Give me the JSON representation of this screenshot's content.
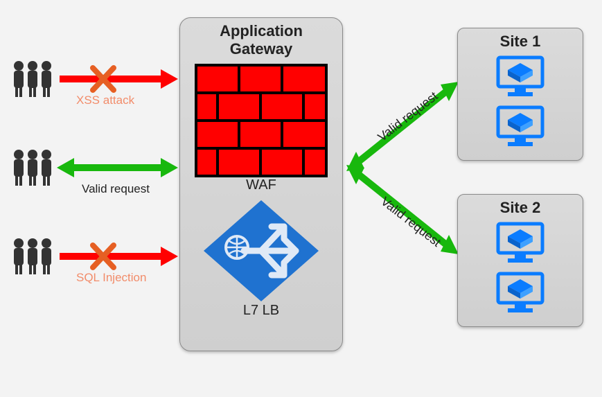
{
  "gateway": {
    "title_line1": "Application",
    "title_line2": "Gateway",
    "waf": "WAF",
    "l7lb": "L7 LB"
  },
  "attacks": {
    "xss": "XSS attack",
    "sql": "SQL Injection",
    "valid": "Valid request"
  },
  "sites": {
    "site1": "Site 1",
    "site2": "Site 2"
  },
  "flows": {
    "to_site1": "Valid request",
    "to_site2": "Valid request"
  },
  "colors": {
    "red": "#ff0000",
    "green": "#18b80d",
    "orange": "#e65f23",
    "azure": "#1f72d0",
    "dark": "#333333"
  }
}
